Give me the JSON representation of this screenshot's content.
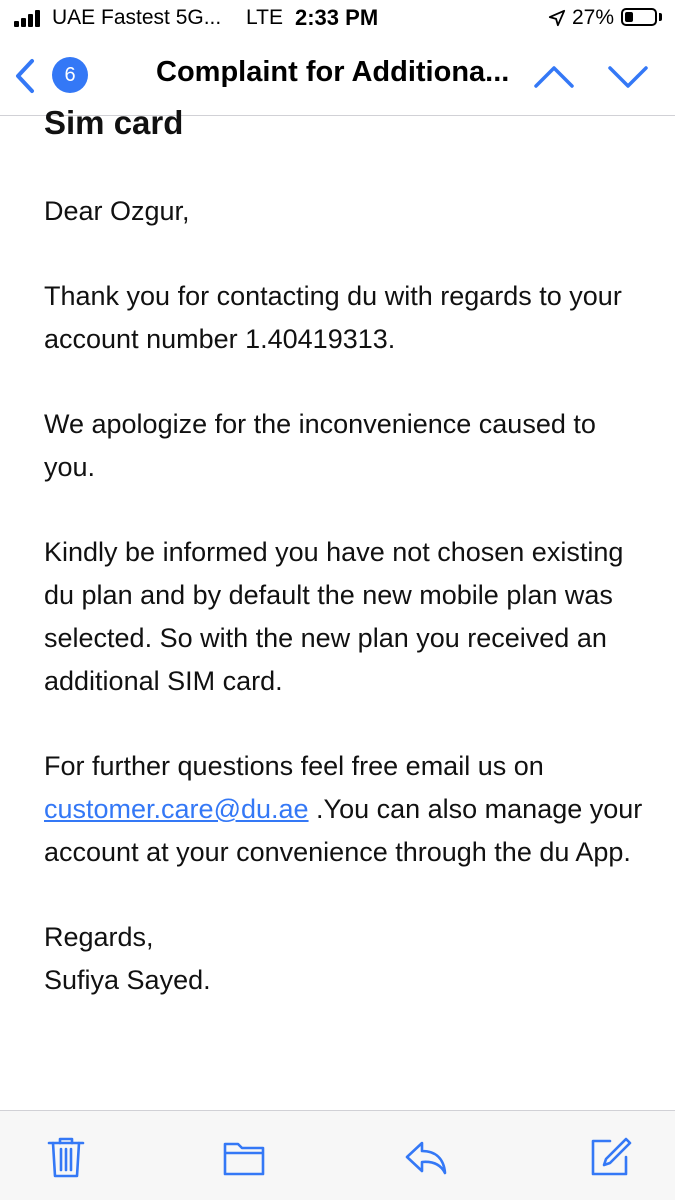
{
  "status_bar": {
    "carrier": "UAE Fastest 5G...",
    "network": "LTE",
    "time": "2:33 PM",
    "battery_percent": "27%",
    "battery_level": 0.27,
    "icons": [
      "signal-bars-icon",
      "location-arrow-icon",
      "battery-icon"
    ]
  },
  "nav": {
    "unread_count": "6",
    "title": "Complaint for Additiona...",
    "icons": [
      "back-chevron-icon",
      "chevron-up-icon",
      "chevron-down-icon"
    ]
  },
  "email": {
    "subject_fragment": "Sim card",
    "greeting": "Dear Ozgur,",
    "paragraph_1": "Thank you for contacting du with regards to your account number 1.40419313.",
    "paragraph_2": "We apologize for the inconvenience caused to you.",
    "paragraph_3": "Kindly be informed you have not chosen existing du plan and by default the new mobile plan was selected. So with the new plan you received an additional SIM card.",
    "paragraph_4_before": "For further questions feel free email us on ",
    "paragraph_4_link": "customer.care@du.ae",
    "paragraph_4_after": " .You can also manage your account at your convenience through the du App.",
    "signoff": "Regards,",
    "signature": "Sufiya Sayed."
  },
  "toolbar": {
    "icons": [
      "trash-icon",
      "folder-icon",
      "reply-icon",
      "compose-icon"
    ]
  },
  "colors": {
    "accent": "#3478f6",
    "text": "#111111",
    "toolbar_bg": "#f7f7f7",
    "separator": "#d1d1d6"
  }
}
